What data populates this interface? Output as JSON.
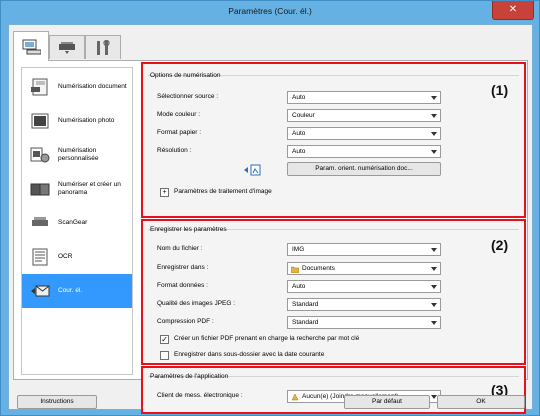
{
  "window": {
    "title": "Paramètres (Cour. él.)",
    "close_label": "✕"
  },
  "tabs": [
    {
      "name": "scan-from-computer"
    },
    {
      "name": "scan-from-operation-panel"
    },
    {
      "name": "general-settings"
    }
  ],
  "nav": {
    "items": [
      {
        "label": "Numérisation document"
      },
      {
        "label": "Numérisation photo"
      },
      {
        "label": "Numérisation personnalisée"
      },
      {
        "label": "Numériser et créer un panorama"
      },
      {
        "label": "ScanGear"
      },
      {
        "label": "OCR"
      },
      {
        "label": "Cour. él."
      }
    ],
    "selected_index": 6
  },
  "scan_options": {
    "title": "Options de numérisation",
    "fields": [
      {
        "label": "Sélectionner source :",
        "value": "Auto"
      },
      {
        "label": "Mode couleur :",
        "value": "Couleur"
      },
      {
        "label": "Format papier :",
        "value": "Auto"
      },
      {
        "label": "Résolution :",
        "value": "Auto"
      }
    ],
    "orientation_button": "Param. orient. numérisation doc...",
    "image_processing_label": "Paramètres de traitement d'image",
    "expand_glyph": "+",
    "number_label": "(1)"
  },
  "save_settings": {
    "title": "Enregistrer les paramètres",
    "fields": [
      {
        "label": "Nom du fichier :",
        "value": "IMG"
      },
      {
        "label": "Enregistrer dans :",
        "value": "Documents"
      },
      {
        "label": "Format données :",
        "value": "Auto"
      },
      {
        "label": "Qualité des images JPEG :",
        "value": "Standard"
      },
      {
        "label": "Compression PDF :",
        "value": "Standard"
      }
    ],
    "checkbox_keyword": {
      "label": "Créer un fichier PDF prenant en charge la recherche par mot clé",
      "checked": true
    },
    "checkbox_subfolder": {
      "label": "Enregistrer dans sous-dossier avec la date courante",
      "checked": false
    },
    "check_glyph": "✓",
    "number_label": "(2)"
  },
  "app_settings": {
    "title": "Paramètres de l'application",
    "label": "Client de mess. électronique :",
    "value": "Aucun(e) (Joindre manuellement)",
    "number_label": "(3)"
  },
  "footer": {
    "instructions": "Instructions",
    "defaults": "Par défaut",
    "ok": "OK"
  },
  "colors": {
    "highlight_border": "#e8101c",
    "selection": "#3399ff",
    "window_frame": "#65b1e3"
  }
}
